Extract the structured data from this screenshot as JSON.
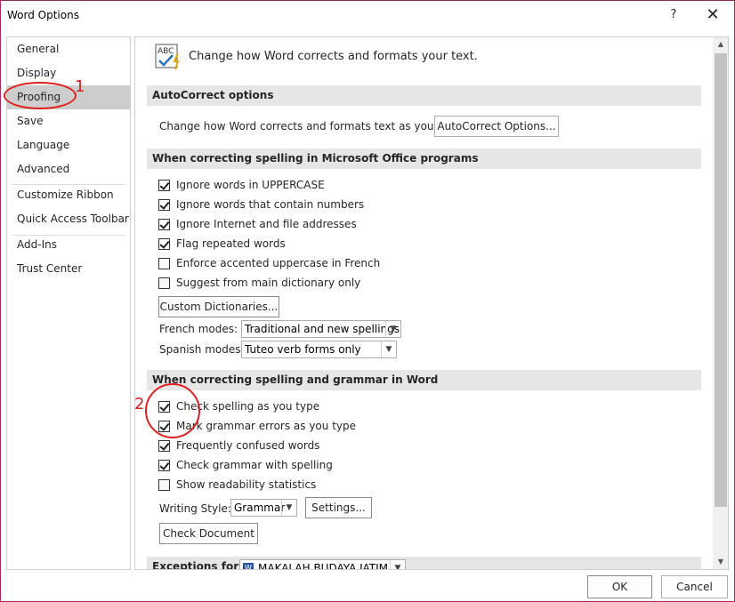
{
  "window": {
    "title": "Word Options",
    "help_symbol": "?",
    "close_symbol": "✕"
  },
  "nav": {
    "items": [
      "General",
      "Display",
      "Proofing",
      "Save",
      "Language",
      "Advanced",
      "Customize Ribbon",
      "Quick Access Toolbar",
      "Add-Ins",
      "Trust Center"
    ],
    "selected": "Proofing"
  },
  "header": {
    "text": "Change how Word corrects and formats your text.",
    "icon": "abc-check-icon",
    "icon_text": "ABC"
  },
  "autocorrect": {
    "section_title": "AutoCorrect options",
    "description": "Change how Word corrects and formats text as you type:",
    "button_label": "AutoCorrect Options..."
  },
  "office_spelling": {
    "section_title": "When correcting spelling in Microsoft Office programs",
    "options": [
      {
        "label": "Ignore words in UPPERCASE",
        "checked": true
      },
      {
        "label": "Ignore words that contain numbers",
        "checked": true
      },
      {
        "label": "Ignore Internet and file addresses",
        "checked": true
      },
      {
        "label": "Flag repeated words",
        "checked": true
      },
      {
        "label": "Enforce accented uppercase in French",
        "checked": false
      },
      {
        "label": "Suggest from main dictionary only",
        "checked": false
      }
    ],
    "custom_dict_button": "Custom Dictionaries...",
    "french_label": "French modes:",
    "french_value": "Traditional and new spellings",
    "spanish_label": "Spanish modes:",
    "spanish_value": "Tuteo verb forms only"
  },
  "word_spelling": {
    "section_title": "When correcting spelling and grammar in Word",
    "options": [
      {
        "label": "Check spelling as you type",
        "checked": true
      },
      {
        "label": "Mark grammar errors as you type",
        "checked": true
      },
      {
        "label": "Frequently confused words",
        "checked": true
      },
      {
        "label": "Check grammar with spelling",
        "checked": true
      },
      {
        "label": "Show readability statistics",
        "checked": false
      }
    ],
    "writing_style_label": "Writing Style:",
    "writing_style_value": "Grammar",
    "settings_button": "Settings...",
    "check_document_button": "Check Document"
  },
  "exceptions": {
    "label": "Exceptions for:",
    "document": "MAKALAH BUDAYA JATIM"
  },
  "footer": {
    "ok": "OK",
    "cancel": "Cancel"
  },
  "annotations": {
    "first": "1",
    "second": "2"
  },
  "colors": {
    "annotation": "#e02020",
    "selected_nav": "#cdcdcd",
    "section_bg": "#e6e6e6"
  }
}
